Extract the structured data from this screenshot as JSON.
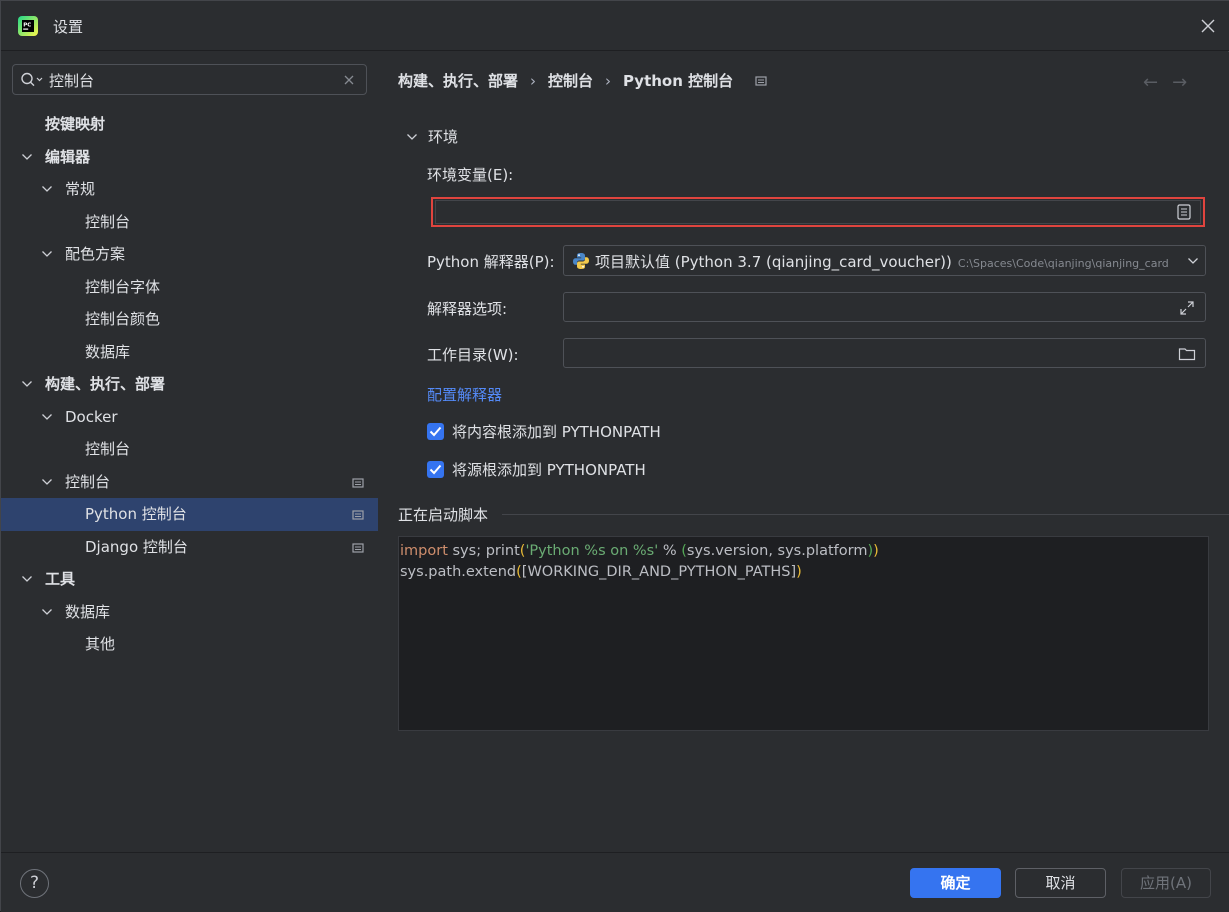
{
  "window": {
    "title": "设置"
  },
  "sidebar": {
    "search": {
      "value": "控制台"
    },
    "tree": [
      {
        "label": "按键映射",
        "level": 0,
        "bold": true,
        "expandable": false
      },
      {
        "label": "编辑器",
        "level": 0,
        "bold": true,
        "expandable": true
      },
      {
        "label": "常规",
        "level": 1,
        "expandable": true
      },
      {
        "label": "控制台",
        "level": 2
      },
      {
        "label": "配色方案",
        "level": 1,
        "expandable": true
      },
      {
        "label": "控制台字体",
        "level": 2
      },
      {
        "label": "控制台颜色",
        "level": 2
      },
      {
        "label": "数据库",
        "level": 2
      },
      {
        "label": "构建、执行、部署",
        "level": 0,
        "bold": true,
        "expandable": true
      },
      {
        "label": "Docker",
        "level": 1,
        "expandable": true
      },
      {
        "label": "控制台",
        "level": 2
      },
      {
        "label": "控制台",
        "level": 1,
        "expandable": true,
        "page_icon": true
      },
      {
        "label": "Python 控制台",
        "level": 2,
        "selected": true,
        "page_icon": true
      },
      {
        "label": "Django 控制台",
        "level": 2,
        "page_icon": true
      },
      {
        "label": "工具",
        "level": 0,
        "bold": true,
        "expandable": true
      },
      {
        "label": "数据库",
        "level": 1,
        "expandable": true
      },
      {
        "label": "其他",
        "level": 2
      }
    ]
  },
  "breadcrumb": {
    "items": [
      "构建、执行、部署",
      "控制台",
      "Python 控制台"
    ],
    "separator": "›"
  },
  "nav": {
    "back": "←",
    "forward": "→"
  },
  "section": {
    "title": "环境"
  },
  "fields": {
    "env_label": "环境变量(E):",
    "env_value": "",
    "interpreter_label": "Python 解释器(P):",
    "interpreter_value": "项目默认值 (Python 3.7 (qianjing_card_voucher))",
    "interpreter_path": "C:\\Spaces\\Code\\qianjing\\qianjing_card",
    "options_label": "解释器选项:",
    "options_value": "",
    "workdir_label": "工作目录(W):",
    "workdir_value": ""
  },
  "configure_link": "配置解释器",
  "checkboxes": [
    {
      "label": "将内容根添加到 PYTHONPATH",
      "checked": true
    },
    {
      "label": "将源根添加到 PYTHONPATH",
      "checked": true
    }
  ],
  "startup": {
    "title": "正在启动脚本",
    "code": {
      "l1_kw": "import",
      "l1_a": " sys; ",
      "l1_fn": "print",
      "l1_p1": "(",
      "l1_str": "'Python %s on %s'",
      "l1_b": " % ",
      "l1_p2": "(",
      "l1_c": "sys.version, sys.platform",
      "l1_p3": ")",
      "l1_p4": ")",
      "l2_a": "sys.path.extend",
      "l2_p1": "(",
      "l2_b": "[WORKING_DIR_AND_PYTHON_PATHS]",
      "l2_p2": ")"
    }
  },
  "footer": {
    "help": "?",
    "ok": "确定",
    "cancel": "取消",
    "apply": "应用(A)"
  },
  "colors": {
    "accent": "#3574f0",
    "selection": "#2e436e",
    "highlight_border": "#e0443e",
    "link": "#548af7",
    "background": "#2b2d30"
  }
}
